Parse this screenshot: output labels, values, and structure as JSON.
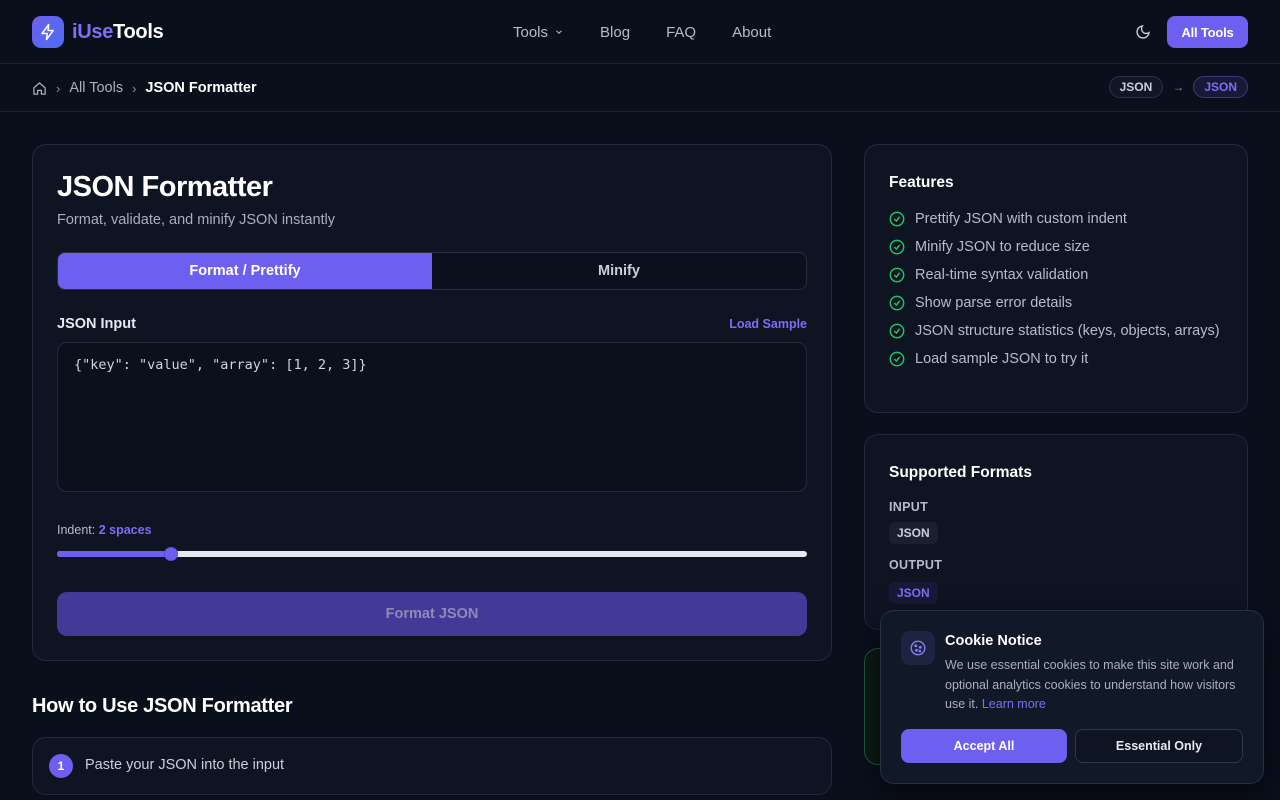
{
  "brand": {
    "name_part1": "iUse",
    "name_part2": "Tools"
  },
  "nav": {
    "items": [
      "Tools",
      "Blog",
      "FAQ",
      "About"
    ],
    "cta": "All Tools"
  },
  "breadcrumb": {
    "all_tools": "All Tools",
    "current": "JSON Formatter"
  },
  "conversion": {
    "from": "JSON",
    "to": "JSON"
  },
  "main": {
    "title": "JSON Formatter",
    "subtitle": "Format, validate, and minify JSON instantly",
    "tabs": [
      {
        "label": "Format / Prettify",
        "active": true
      },
      {
        "label": "Minify",
        "active": false
      }
    ],
    "input_label": "JSON Input",
    "load_sample": "Load Sample",
    "input_value": "{\"key\": \"value\", \"array\": [1, 2, 3]}",
    "indent_label": "Indent:",
    "indent_value": "2 spaces",
    "indent_fraction": 0.152,
    "format_button": "Format JSON"
  },
  "howto": {
    "title": "How to Use JSON Formatter",
    "steps": [
      {
        "num": "1",
        "text": "Paste your JSON into the input"
      }
    ]
  },
  "features": {
    "title": "Features",
    "items": [
      "Prettify JSON with custom indent",
      "Minify JSON to reduce size",
      "Real-time syntax validation",
      "Show parse error details",
      "JSON structure statistics (keys, objects, arrays)",
      "Load sample JSON to try it"
    ]
  },
  "supported_formats": {
    "title": "Supported Formats",
    "input_label": "INPUT",
    "input_formats": [
      "JSON"
    ],
    "output_label": "OUTPUT",
    "output_formats": [
      "JSON"
    ]
  },
  "cookie": {
    "title": "Cookie Notice",
    "text": "We use essential cookies to make this site work and optional analytics cookies to understand how visitors use it.",
    "learn_more": "Learn more",
    "accept": "Accept All",
    "essential": "Essential Only"
  },
  "colors": {
    "accent": "#6d5ff0",
    "background": "#0a0f1c",
    "check_green": "#22c55e"
  }
}
